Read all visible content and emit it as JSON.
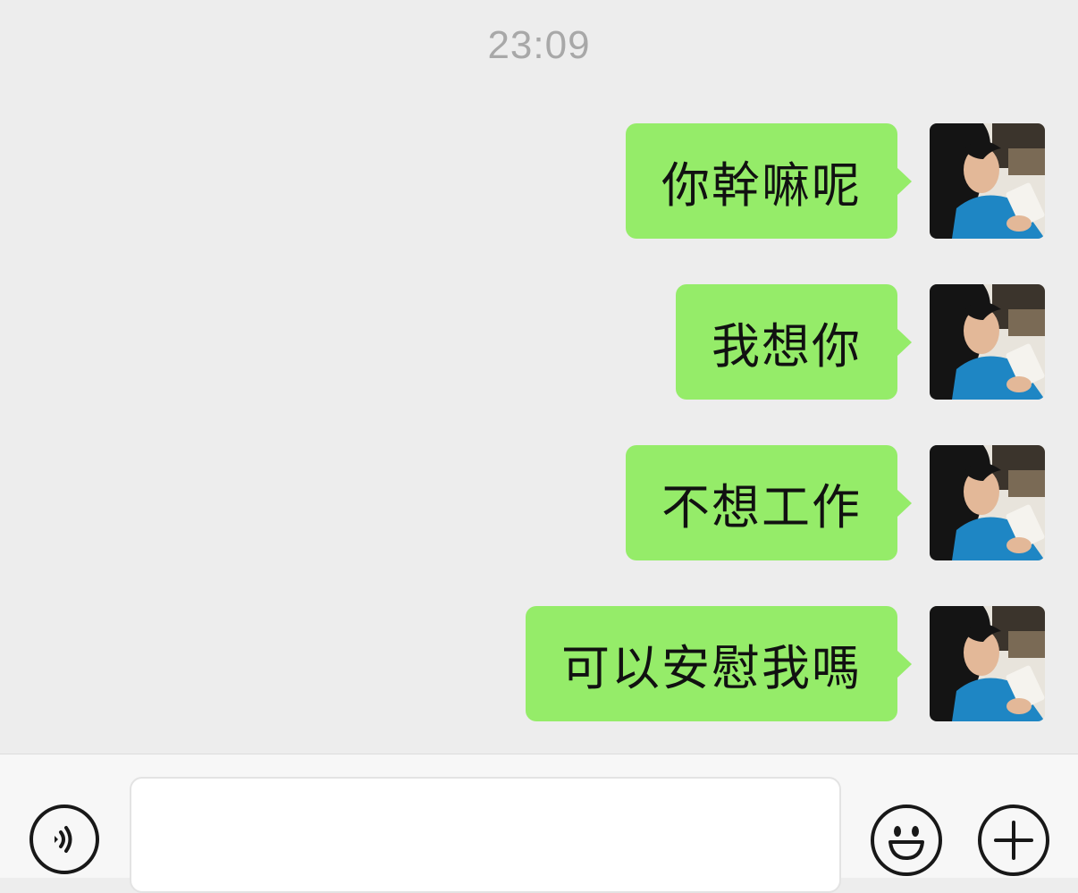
{
  "chat": {
    "timestamp": "23:09",
    "messages": [
      {
        "text": "你幹嘛呢",
        "sender": "self"
      },
      {
        "text": "我想你",
        "sender": "self"
      },
      {
        "text": "不想工作",
        "sender": "self"
      },
      {
        "text": "可以安慰我嗎",
        "sender": "self"
      }
    ]
  },
  "input_bar": {
    "text_value": "",
    "voice_icon": "voice-icon",
    "emoji_icon": "emoji-icon",
    "plus_icon": "plus-icon"
  },
  "colors": {
    "background": "#ededed",
    "bubble": "#95ec69",
    "timestamp": "#a8a8a8",
    "input_bar": "#f7f7f7"
  }
}
